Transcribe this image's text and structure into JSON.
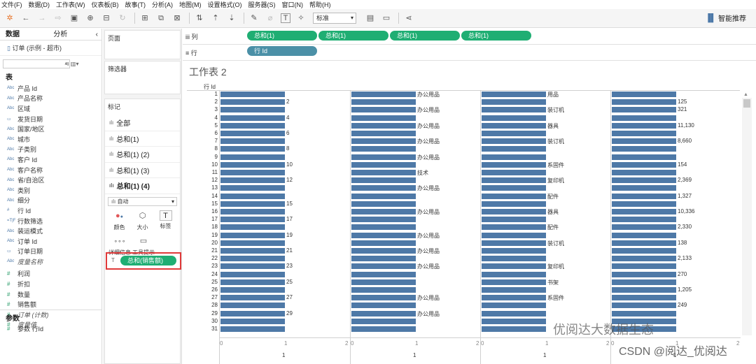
{
  "menu": [
    "文件(F)",
    "数据(D)",
    "工作表(W)",
    "仪表板(B)",
    "故事(T)",
    "分析(A)",
    "地图(M)",
    "设置格式(O)",
    "服务器(S)",
    "窗口(N)",
    "帮助(H)"
  ],
  "toolbar": {
    "fit_select": "标准",
    "smart_label": "智能推荐"
  },
  "datapane": {
    "tab_data": "数据",
    "tab_analytics": "分析",
    "datasource": "订单 (示例 - 超市)",
    "tables_title": "表",
    "fields": [
      {
        "type": "Abc",
        "name": "产品 Id"
      },
      {
        "type": "Abc",
        "name": "产品名称"
      },
      {
        "type": "Abc",
        "name": "区域"
      },
      {
        "type": "▭",
        "name": "发货日期"
      },
      {
        "type": "Abc",
        "name": "国家/地区"
      },
      {
        "type": "Abc",
        "name": "城市"
      },
      {
        "type": "Abc",
        "name": "子类别"
      },
      {
        "type": "Abc",
        "name": "客户 Id"
      },
      {
        "type": "Abc",
        "name": "客户名称"
      },
      {
        "type": "Abc",
        "name": "省/自治区"
      },
      {
        "type": "Abc",
        "name": "类别"
      },
      {
        "type": "Abc",
        "name": "细分"
      },
      {
        "type": "#",
        "name": "行 Id"
      },
      {
        "type": "=T|F",
        "name": "行数筛选"
      },
      {
        "type": "Abc",
        "name": "装运模式"
      },
      {
        "type": "Abc",
        "name": "订单 Id"
      },
      {
        "type": "▭",
        "name": "订单日期"
      },
      {
        "type": "Abc",
        "name": "度量名称",
        "italic": true
      }
    ],
    "measures": [
      {
        "type": "#",
        "name": "利润"
      },
      {
        "type": "#",
        "name": "折扣"
      },
      {
        "type": "#",
        "name": "数量"
      },
      {
        "type": "#",
        "name": "销售额"
      },
      {
        "type": "#",
        "name": "订单 (计数)",
        "italic": true
      },
      {
        "type": "#",
        "name": "度量值",
        "italic": true
      }
    ],
    "params_title": "参数",
    "param_item": "参数 行Id"
  },
  "cards": {
    "pages": "页面",
    "filters": "筛选器",
    "marks": "标记",
    "marks_rows": [
      "全部",
      "总和(1)",
      "总和(1) (2)",
      "总和(1) (3)",
      "总和(1) (4)"
    ],
    "mark_type": "自动",
    "mark_buttons": [
      "颜色",
      "大小",
      "标签",
      "详细信息",
      "工具提示"
    ],
    "mark_pill": "总和(销售额)"
  },
  "shelves": {
    "columns_label": "列",
    "rows_label": "行",
    "column_pills": [
      "总和(1)",
      "总和(1)",
      "总和(1)",
      "总和(1)"
    ],
    "row_pill": "行 Id"
  },
  "sheet": {
    "title": "工作表 2",
    "row_header": "行 Id",
    "axis_ticks": [
      "0",
      "1",
      "2"
    ],
    "axis_value": "1",
    "rows": [
      1,
      2,
      3,
      4,
      5,
      6,
      7,
      8,
      9,
      10,
      11,
      12,
      13,
      14,
      15,
      16,
      17,
      18,
      19,
      20,
      21,
      22,
      23,
      24,
      25,
      26,
      27,
      28,
      29,
      30,
      31
    ],
    "col1_labels": {
      "2": "2",
      "4": "4",
      "6": "6",
      "8": "8",
      "10": "10",
      "12": "12",
      "15": "15",
      "17": "17",
      "19": "19",
      "21": "21",
      "23": "23",
      "25": "25",
      "27": "27",
      "29": "29"
    },
    "col2_labels": {
      "1": "办公用品",
      "3": "办公用品",
      "5": "办公用品",
      "7": "办公用品",
      "9": "办公用品",
      "11": "技术",
      "13": "办公用品",
      "16": "办公用品",
      "19": "办公用品",
      "21": "办公用品",
      "23": "办公用品",
      "27": "办公用品",
      "29": "办公用品"
    },
    "col3_labels": {
      "1": "用品",
      "3": "装订机",
      "5": "器具",
      "7": "装订机",
      "10": "系固件",
      "12": "复印机",
      "14": "配件",
      "16": "器具",
      "18": "配件",
      "20": "装订机",
      "23": "复印机",
      "25": "书架",
      "27": "系固件"
    },
    "col4_labels": {
      "2": "125",
      "3": "321",
      "5": "11,130",
      "7": "8,660",
      "10": "154",
      "12": "2,369",
      "14": "1,327",
      "16": "10,336",
      "18": "2,330",
      "20": "138",
      "22": "2,133",
      "24": "270",
      "26": "1,205",
      "28": "249"
    }
  },
  "watermark": {
    "line1": "优阅达大数据生态",
    "line2": "CSDN @阅达_优阅达"
  }
}
